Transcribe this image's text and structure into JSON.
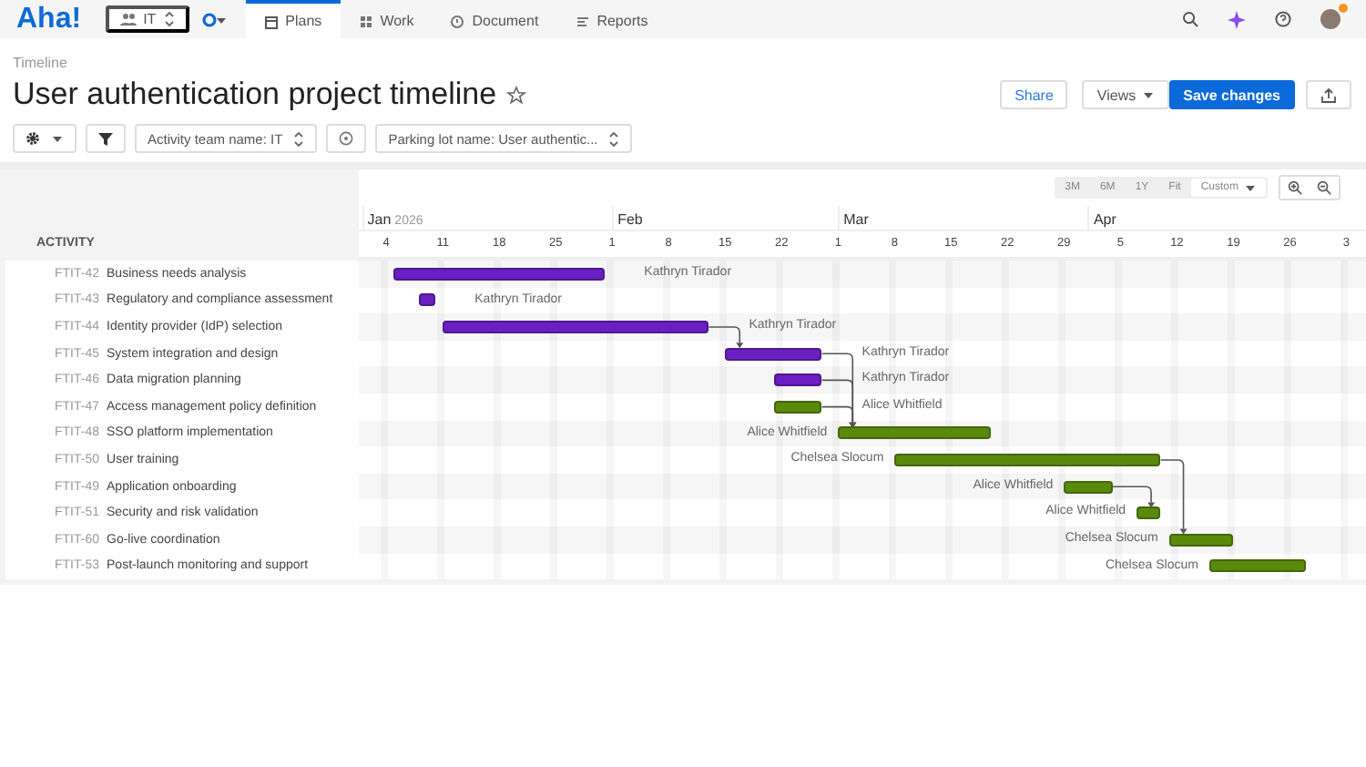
{
  "nav": {
    "logo": "Aha!",
    "workspace": "IT",
    "tabs": [
      {
        "label": "Plans",
        "selected": true
      },
      {
        "label": "Work",
        "selected": false
      },
      {
        "label": "Document",
        "selected": false
      },
      {
        "label": "Reports",
        "selected": false
      }
    ],
    "notification": true
  },
  "breadcrumb": "Timeline",
  "title": "User authentication project timeline",
  "favorite": false,
  "actions": {
    "share": "Share",
    "views": "Views",
    "save": "Save changes"
  },
  "filters": [
    {
      "label": "Activity team name: IT"
    },
    {
      "label": "Parking lot name: User authentic..."
    }
  ],
  "zoom_presets": [
    {
      "label": "3M",
      "selected": false
    },
    {
      "label": "6M",
      "selected": false
    },
    {
      "label": "1Y",
      "selected": false
    },
    {
      "label": "Fit",
      "selected": false
    },
    {
      "label": "Custom",
      "selected": true
    }
  ],
  "activity_header": "ACTIVITY",
  "months": [
    {
      "label": "Jan",
      "year": "2026"
    },
    {
      "label": "Feb"
    },
    {
      "label": "Mar"
    },
    {
      "label": "Apr"
    }
  ],
  "weeks": [
    "4",
    "11",
    "18",
    "25",
    "1",
    "8",
    "15",
    "22",
    "1",
    "8",
    "15",
    "22",
    "29",
    "5",
    "12",
    "19",
    "26",
    "3"
  ],
  "activities": [
    {
      "id": "FTIT-42",
      "name": "Business needs analysis",
      "owner": "Kathryn Tirador",
      "color": "#6a1fc2"
    },
    {
      "id": "FTIT-43",
      "name": "Regulatory and compliance assessment",
      "owner": "Kathryn Tirador",
      "color": "#6a1fc2"
    },
    {
      "id": "FTIT-44",
      "name": "Identity provider (IdP) selection",
      "owner": "Kathryn Tirador",
      "color": "#6a1fc2"
    },
    {
      "id": "FTIT-45",
      "name": "System integration and design",
      "owner": "Kathryn Tirador",
      "color": "#6a1fc2"
    },
    {
      "id": "FTIT-46",
      "name": "Data migration planning",
      "owner": "Kathryn Tirador",
      "color": "#6a1fc2"
    },
    {
      "id": "FTIT-47",
      "name": "Access management policy definition",
      "owner": "Alice Whitfield",
      "color": "#5a8a0c"
    },
    {
      "id": "FTIT-48",
      "name": "SSO platform implementation",
      "owner": "Alice Whitfield",
      "color": "#5a8a0c"
    },
    {
      "id": "FTIT-50",
      "name": "User training",
      "owner": "Chelsea Slocum",
      "color": "#5a8a0c"
    },
    {
      "id": "FTIT-49",
      "name": "Application onboarding",
      "owner": "Alice Whitfield",
      "color": "#5a8a0c"
    },
    {
      "id": "FTIT-51",
      "name": "Security and risk validation",
      "owner": "Alice Whitfield",
      "color": "#5a8a0c"
    },
    {
      "id": "FTIT-60",
      "name": "Go-live coordination",
      "owner": "Chelsea Slocum",
      "color": "#5a8a0c"
    },
    {
      "id": "FTIT-53",
      "name": "Post-launch monitoring and support",
      "owner": "Chelsea Slocum",
      "color": "#5a8a0c"
    }
  ]
}
